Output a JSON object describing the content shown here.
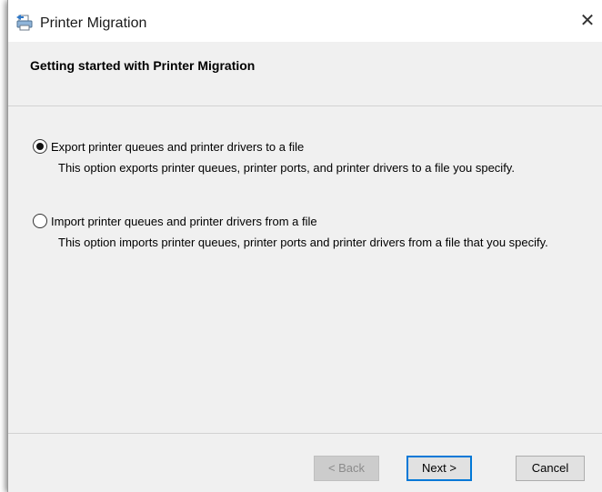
{
  "window": {
    "title": "Printer Migration",
    "close_label": "✕"
  },
  "header": {
    "title": "Getting started with Printer Migration"
  },
  "options": [
    {
      "label": "Export printer queues and printer drivers to a file",
      "description": "This option exports printer queues, printer ports, and printer drivers to a file you specify.",
      "selected": true
    },
    {
      "label": "Import printer queues and printer drivers from a file",
      "description": "This option imports printer queues, printer ports and printer drivers from a file that you specify.",
      "selected": false
    }
  ],
  "buttons": {
    "back": "< Back",
    "next": "Next >",
    "cancel": "Cancel"
  },
  "colors": {
    "accent": "#0078d7",
    "background": "#f0f0f0"
  }
}
